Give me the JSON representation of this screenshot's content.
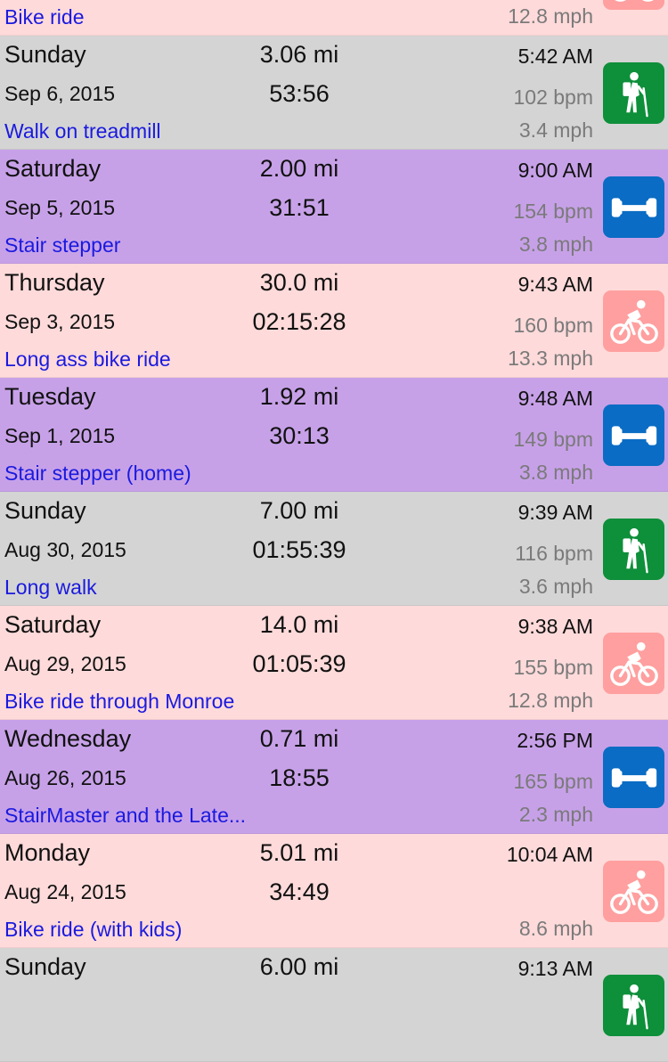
{
  "colors": {
    "walk_row": "#d4d4d4",
    "stair_row": "#c7a1e8",
    "bike_row": "#ffdada",
    "walk_icon": "#0e8f3a",
    "stair_icon": "#0a6cc4",
    "bike_icon": "#ff9f9f",
    "note_text": "#1a1adf"
  },
  "workouts": [
    {
      "type": "bike",
      "icon": "cyclist-icon",
      "day": "",
      "date": "",
      "note": "Bike ride",
      "distance": "",
      "duration": "",
      "time": "",
      "bpm": "",
      "speed": "12.8 mph"
    },
    {
      "type": "walk",
      "icon": "hiker-icon",
      "day": "Sunday",
      "date": "Sep 6, 2015",
      "note": "Walk on treadmill",
      "distance": "3.06 mi",
      "duration": "53:56",
      "time": "5:42 AM",
      "bpm": "102 bpm",
      "speed": "3.4 mph"
    },
    {
      "type": "stair",
      "icon": "dumbbell-icon",
      "day": "Saturday",
      "date": "Sep 5, 2015",
      "note": "Stair stepper",
      "distance": "2.00 mi",
      "duration": "31:51",
      "time": "9:00 AM",
      "bpm": "154 bpm",
      "speed": "3.8 mph"
    },
    {
      "type": "bike",
      "icon": "cyclist-icon",
      "day": "Thursday",
      "date": "Sep 3, 2015",
      "note": "Long ass bike ride",
      "distance": "30.0 mi",
      "duration": "02:15:28",
      "time": "9:43 AM",
      "bpm": "160 bpm",
      "speed": "13.3 mph"
    },
    {
      "type": "stair",
      "icon": "dumbbell-icon",
      "day": "Tuesday",
      "date": "Sep 1, 2015",
      "note": "Stair stepper (home)",
      "distance": "1.92 mi",
      "duration": "30:13",
      "time": "9:48 AM",
      "bpm": "149 bpm",
      "speed": "3.8 mph"
    },
    {
      "type": "walk",
      "icon": "hiker-icon",
      "day": "Sunday",
      "date": "Aug 30, 2015",
      "note": "Long walk",
      "distance": "7.00 mi",
      "duration": "01:55:39",
      "time": "9:39 AM",
      "bpm": "116 bpm",
      "speed": "3.6 mph"
    },
    {
      "type": "bike",
      "icon": "cyclist-icon",
      "day": "Saturday",
      "date": "Aug 29, 2015",
      "note": "Bike ride through Monroe",
      "distance": "14.0 mi",
      "duration": "01:05:39",
      "time": "9:38 AM",
      "bpm": "155 bpm",
      "speed": "12.8 mph"
    },
    {
      "type": "stair",
      "icon": "dumbbell-icon",
      "day": "Wednesday",
      "date": "Aug 26, 2015",
      "note": "StairMaster and the Late...",
      "distance": "0.71 mi",
      "duration": "18:55",
      "time": "2:56 PM",
      "bpm": "165 bpm",
      "speed": "2.3 mph"
    },
    {
      "type": "bike",
      "icon": "cyclist-icon",
      "day": "Monday",
      "date": "Aug 24, 2015",
      "note": "Bike ride (with kids)",
      "distance": "5.01 mi",
      "duration": "34:49",
      "time": "10:04 AM",
      "bpm": "",
      "speed": "8.6 mph"
    },
    {
      "type": "walk",
      "icon": "hiker-icon",
      "day": "Sunday",
      "date": "",
      "note": "",
      "distance": "6.00 mi",
      "duration": "",
      "time": "9:13 AM",
      "bpm": "",
      "speed": ""
    }
  ]
}
